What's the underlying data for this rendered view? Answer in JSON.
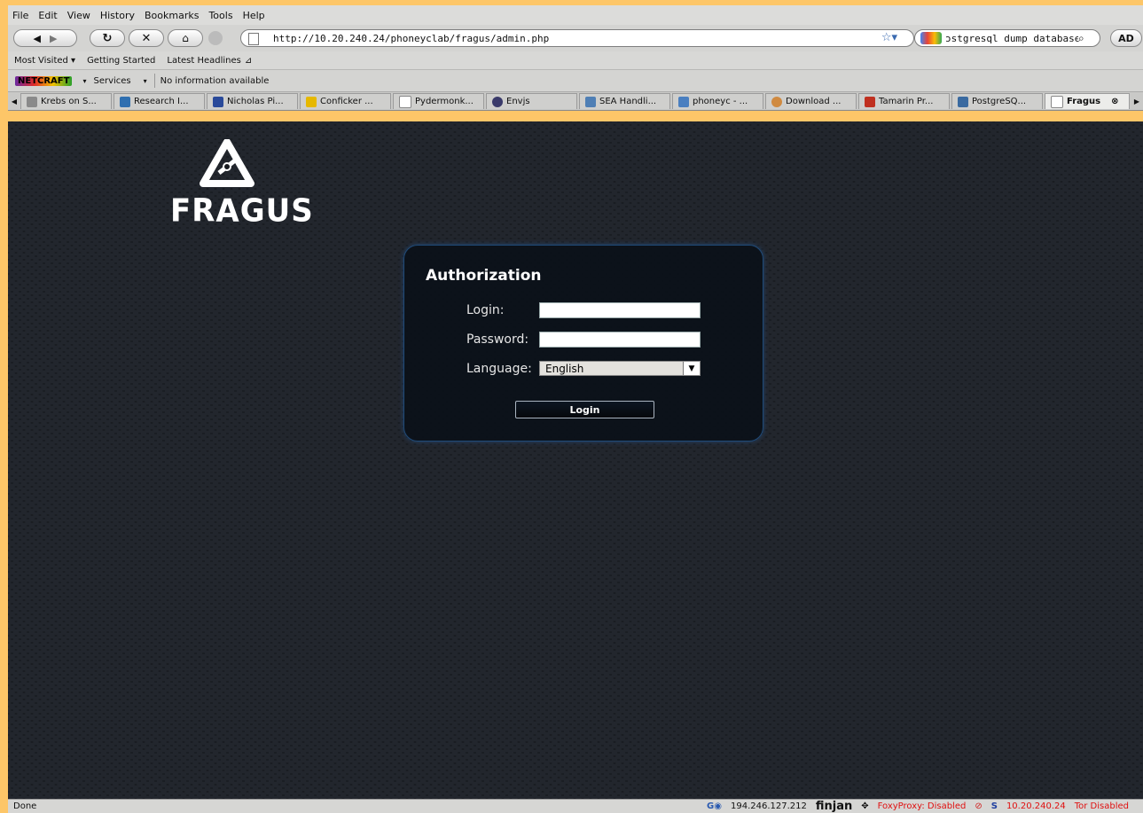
{
  "menu": [
    "File",
    "Edit",
    "View",
    "History",
    "Bookmarks",
    "Tools",
    "Help"
  ],
  "url": "http://10.20.240.24/phoneyclab/fragus/admin.php",
  "search_text": "ɔstgresql dump database",
  "ad_button": "AD",
  "bookmarks": [
    "Most Visited ▾",
    "Getting Started",
    "Latest Headlines"
  ],
  "toolbar": {
    "brand": "NETCRAFT",
    "services": "Services",
    "info": "No information available"
  },
  "tabs": [
    {
      "label": "Krebs on S...",
      "color": "#8a8a8a"
    },
    {
      "label": "Research I...",
      "color": "#2f6fb0"
    },
    {
      "label": "Nicholas Pi...",
      "color": "#2a4a9a"
    },
    {
      "label": "Conficker ...",
      "color": "#e6b800"
    },
    {
      "label": "Pydermonk...",
      "color": "#ffffff"
    },
    {
      "label": "Envjs",
      "color": "#3a3a6a"
    },
    {
      "label": "SEA Handli...",
      "color": "#4f7fb5"
    },
    {
      "label": "phoneyc - ...",
      "color": "#4a7fc0"
    },
    {
      "label": "Download ...",
      "color": "#d08a40"
    },
    {
      "label": "Tamarin Pr...",
      "color": "#c03020"
    },
    {
      "label": "PostgreSQ...",
      "color": "#3a6aa0"
    },
    {
      "label": "Fragus",
      "color": "#ffffff"
    }
  ],
  "page": {
    "logo_text": "FRAGUS",
    "title": "Authorization",
    "login_label": "Login:",
    "password_label": "Password:",
    "language_label": "Language:",
    "language_value": "English",
    "login_button": "Login"
  },
  "status": {
    "left": "Done",
    "ip": "194.246.127.212",
    "finjan": "finjan",
    "foxyproxy": "FoxyProxy: Disabled",
    "local_ip": "10.20.240.24",
    "tor": "Tor Disabled"
  }
}
